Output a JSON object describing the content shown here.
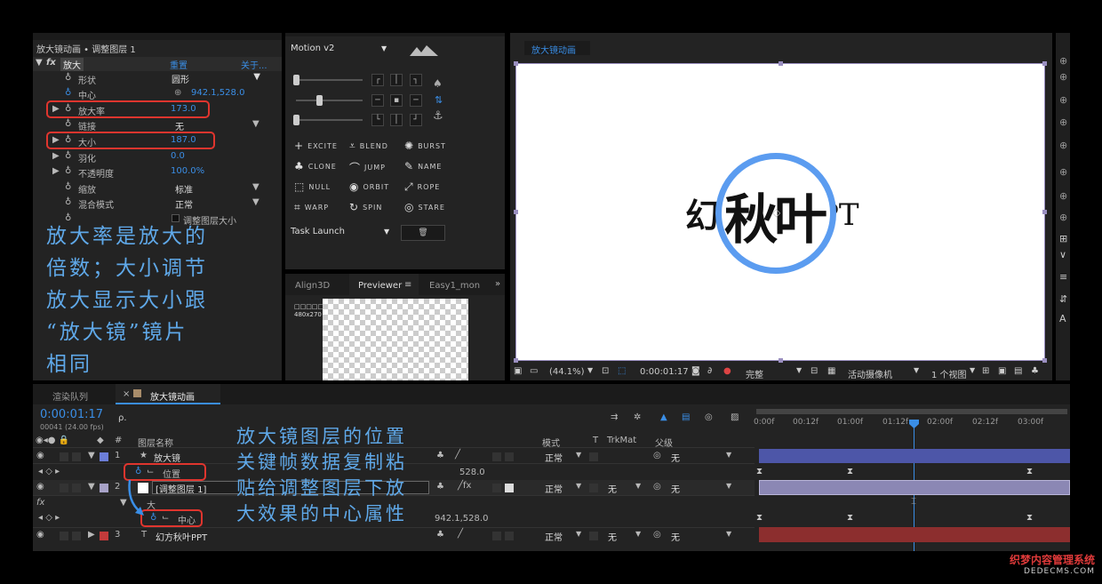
{
  "effects_panel": {
    "header": "放大镜动画 • 调整图层 1",
    "effect_name": "放大",
    "reset": "重置",
    "about": "关于...",
    "props": {
      "shape": {
        "label": "形状",
        "value": "圆形"
      },
      "center": {
        "label": "中心",
        "value": "942.1,528.0"
      },
      "magnification": {
        "label": "放大率",
        "value": "173.0"
      },
      "link": {
        "label": "链接",
        "value": "无"
      },
      "size": {
        "label": "大小",
        "value": "187.0"
      },
      "feather": {
        "label": "羽化",
        "value": "0.0"
      },
      "opacity": {
        "label": "不透明度",
        "value": "100.0%"
      },
      "scaling": {
        "label": "缩放",
        "value": "标准"
      },
      "blend_mode": {
        "label": "混合模式",
        "value": "正常"
      },
      "resize_layer": {
        "label": "调整图层大小"
      }
    },
    "annotation": [
      "放大率是放大的",
      "倍数；大小调节",
      "放大显示大小跟",
      "“放大镜”镜片",
      "相同"
    ]
  },
  "motion_panel": {
    "title": "Motion v2",
    "buttons": {
      "excite": "EXCITE",
      "blend": "BLEND",
      "burst": "BURST",
      "clone": "CLONE",
      "jump": "JUMP",
      "name": "NAME",
      "null": "NULL",
      "orbit": "ORBIT",
      "rope": "ROPE",
      "warp": "WARP",
      "spin": "SPIN",
      "stare": "STARE"
    },
    "task_launch": "Task Launch"
  },
  "previewer_panel": {
    "tabs": {
      "align": "Align3D",
      "previewer": "Previewer",
      "easy": "Easy1_mon"
    },
    "label": "□□□□□□",
    "resolution": "480x270"
  },
  "composition": {
    "tab": "放大镜动画",
    "text_left": "幻",
    "text_mid": "秋叶",
    "text_right": "PT",
    "footer": {
      "zoom": "(44.1%)",
      "time": "0:00:01:17",
      "quality": "完整",
      "camera": "活动摄像机",
      "views": "1 个视图"
    }
  },
  "timeline": {
    "tab_render": "渲染队列",
    "tab_comp": "放大镜动画",
    "timecode": "0:00:01:17",
    "frames": "00041 (24.00 fps)",
    "search_icon": "ρ.",
    "col_layer_name": "图层名称",
    "col_mode": "模式",
    "col_t": "T",
    "col_trkmat": "TrkMat",
    "col_parent": "父级",
    "col_num": "#",
    "ruler": [
      "0:00f",
      "00:12f",
      "01:00f",
      "01:12f",
      "02:00f",
      "02:12f",
      "03:00f"
    ],
    "layers": [
      {
        "num": "1",
        "name": "放大镜",
        "mode": "正常",
        "parent": "无",
        "sub_prop": "位置",
        "sub_value": "528.0"
      },
      {
        "num": "2",
        "name": "[调整图层 1]",
        "mode": "正常",
        "trkmat": "无",
        "parent": "无",
        "effect": "大",
        "sub_prop": "中心",
        "sub_value": "942.1,528.0"
      },
      {
        "num": "3",
        "name": "幻方秋叶PPT",
        "mode": "正常",
        "trkmat": "无",
        "parent": "无"
      }
    ],
    "annotation": [
      "放大镜图层的位置",
      "关键帧数据复制粘",
      "贴给调整图层下放",
      "大效果的中心属性"
    ]
  },
  "watermark": {
    "line1": "织梦内容管理系统",
    "line2": "DEDECMS.COM"
  },
  "colors": {
    "accent": "#3a8ee6",
    "highlight": "#e0352e",
    "annotation": "#5fa8e8",
    "circle": "#5b9cf0",
    "label_blue": "#6c7ed8",
    "label_red": "#c23b3b"
  }
}
